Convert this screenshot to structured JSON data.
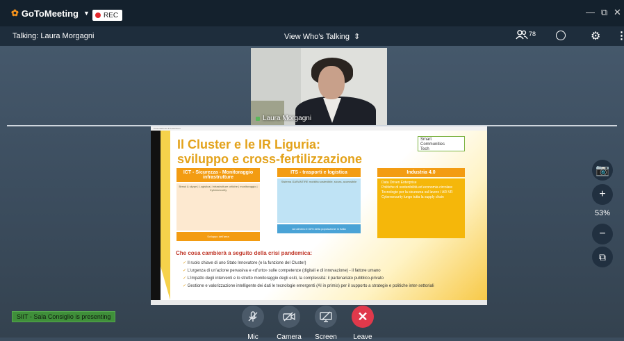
{
  "app": {
    "brand": "GoToMeeting",
    "brand_flower_icon": "gotomeeting-flower-icon",
    "rec_label": "REC"
  },
  "window": {
    "minimize": "—",
    "restore": "⧉",
    "close": "✕"
  },
  "subbar": {
    "talking": "Talking: Laura Morgagni",
    "view_label": "View Who's Talking",
    "attendee_count": "78"
  },
  "webcam": {
    "name": "Laura Morgagni"
  },
  "slide": {
    "window_title": "Presentazione di PowerPoint",
    "title_line1": "Il Cluster e le IR Liguria:",
    "title_line2": "sviluppo e cross-fertilizzazione",
    "logo_line1": "Smart",
    "logo_line2": "Communities",
    "logo_line3": "Tech",
    "col1_header": "ICT - Sicurezza - Monitoraggio infrastrutture",
    "col1_body": "Break & skype | Logistica | Infrastrutture critiche | monitoraggio | Cybersecurity",
    "col1_footer": "Sviluppo dell'area",
    "col2_header": "ITS - trasporti e logistica",
    "col2_body": "Sistema GARANTIRE mobilità sostenibile, sicura, accessibile",
    "col2_footer": "Ad almeno il 30% della popolazione in Italia",
    "col3_header": "Industria 4.0",
    "col3_items": [
      "Data Driven Enterprise",
      "Politiche di sostenibilità ed economia circolare",
      "Tecnologie per la sicurezza sul lavoro / AR-VR",
      "Cybersecurity lungo tutta la supply chain"
    ],
    "question": "Che cosa cambierà a seguito della crisi pandemica:",
    "bullets": [
      "Il ruolo chiave di uno Stato Innovatore (e la funzione del Cluster)",
      "L'urgenza di un'azione pervasiva e «d'urto» sulle competenze (digitali e di innovazione) - il fattore umano",
      "L'impatto degli interventi e lo stretto monitoraggio degli esiti, la complessità: il partenariato pubblico-privato",
      "Gestione e valorizzazione intelligente dei dati le tecnologie emergenti (AI in primis) per il supporto a strategie e politiche inter-settoriali"
    ]
  },
  "side": {
    "zoom": "53%"
  },
  "footer": {
    "presenting": "SIIT - Sala Consiglio is presenting"
  },
  "controls": {
    "mic": "Mic",
    "camera": "Camera",
    "screen": "Screen",
    "leave": "Leave"
  }
}
